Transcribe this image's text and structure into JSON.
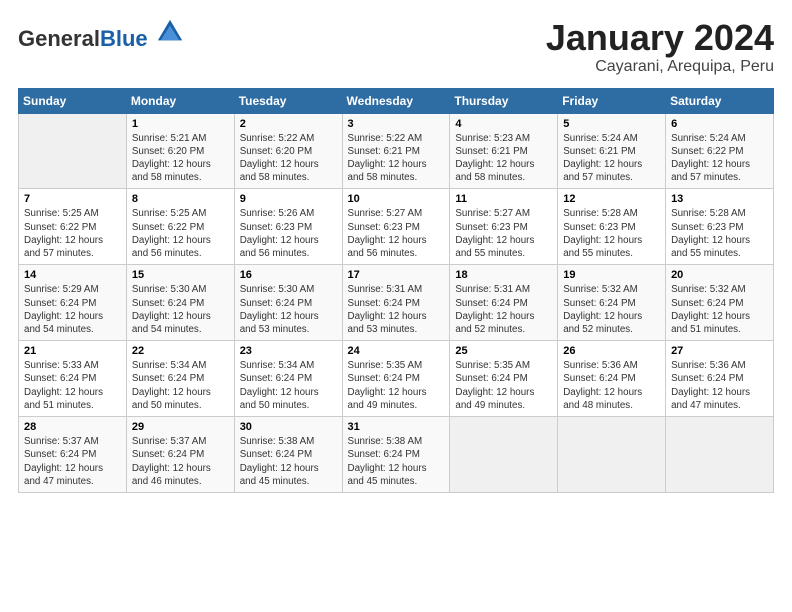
{
  "header": {
    "logo_general": "General",
    "logo_blue": "Blue",
    "month_title": "January 2024",
    "subtitle": "Cayarani, Arequipa, Peru"
  },
  "weekdays": [
    "Sunday",
    "Monday",
    "Tuesday",
    "Wednesday",
    "Thursday",
    "Friday",
    "Saturday"
  ],
  "weeks": [
    [
      {
        "day": "",
        "info": ""
      },
      {
        "day": "1",
        "info": "Sunrise: 5:21 AM\nSunset: 6:20 PM\nDaylight: 12 hours\nand 58 minutes."
      },
      {
        "day": "2",
        "info": "Sunrise: 5:22 AM\nSunset: 6:20 PM\nDaylight: 12 hours\nand 58 minutes."
      },
      {
        "day": "3",
        "info": "Sunrise: 5:22 AM\nSunset: 6:21 PM\nDaylight: 12 hours\nand 58 minutes."
      },
      {
        "day": "4",
        "info": "Sunrise: 5:23 AM\nSunset: 6:21 PM\nDaylight: 12 hours\nand 58 minutes."
      },
      {
        "day": "5",
        "info": "Sunrise: 5:24 AM\nSunset: 6:21 PM\nDaylight: 12 hours\nand 57 minutes."
      },
      {
        "day": "6",
        "info": "Sunrise: 5:24 AM\nSunset: 6:22 PM\nDaylight: 12 hours\nand 57 minutes."
      }
    ],
    [
      {
        "day": "7",
        "info": "Sunrise: 5:25 AM\nSunset: 6:22 PM\nDaylight: 12 hours\nand 57 minutes."
      },
      {
        "day": "8",
        "info": "Sunrise: 5:25 AM\nSunset: 6:22 PM\nDaylight: 12 hours\nand 56 minutes."
      },
      {
        "day": "9",
        "info": "Sunrise: 5:26 AM\nSunset: 6:23 PM\nDaylight: 12 hours\nand 56 minutes."
      },
      {
        "day": "10",
        "info": "Sunrise: 5:27 AM\nSunset: 6:23 PM\nDaylight: 12 hours\nand 56 minutes."
      },
      {
        "day": "11",
        "info": "Sunrise: 5:27 AM\nSunset: 6:23 PM\nDaylight: 12 hours\nand 55 minutes."
      },
      {
        "day": "12",
        "info": "Sunrise: 5:28 AM\nSunset: 6:23 PM\nDaylight: 12 hours\nand 55 minutes."
      },
      {
        "day": "13",
        "info": "Sunrise: 5:28 AM\nSunset: 6:23 PM\nDaylight: 12 hours\nand 55 minutes."
      }
    ],
    [
      {
        "day": "14",
        "info": "Sunrise: 5:29 AM\nSunset: 6:24 PM\nDaylight: 12 hours\nand 54 minutes."
      },
      {
        "day": "15",
        "info": "Sunrise: 5:30 AM\nSunset: 6:24 PM\nDaylight: 12 hours\nand 54 minutes."
      },
      {
        "day": "16",
        "info": "Sunrise: 5:30 AM\nSunset: 6:24 PM\nDaylight: 12 hours\nand 53 minutes."
      },
      {
        "day": "17",
        "info": "Sunrise: 5:31 AM\nSunset: 6:24 PM\nDaylight: 12 hours\nand 53 minutes."
      },
      {
        "day": "18",
        "info": "Sunrise: 5:31 AM\nSunset: 6:24 PM\nDaylight: 12 hours\nand 52 minutes."
      },
      {
        "day": "19",
        "info": "Sunrise: 5:32 AM\nSunset: 6:24 PM\nDaylight: 12 hours\nand 52 minutes."
      },
      {
        "day": "20",
        "info": "Sunrise: 5:32 AM\nSunset: 6:24 PM\nDaylight: 12 hours\nand 51 minutes."
      }
    ],
    [
      {
        "day": "21",
        "info": "Sunrise: 5:33 AM\nSunset: 6:24 PM\nDaylight: 12 hours\nand 51 minutes."
      },
      {
        "day": "22",
        "info": "Sunrise: 5:34 AM\nSunset: 6:24 PM\nDaylight: 12 hours\nand 50 minutes."
      },
      {
        "day": "23",
        "info": "Sunrise: 5:34 AM\nSunset: 6:24 PM\nDaylight: 12 hours\nand 50 minutes."
      },
      {
        "day": "24",
        "info": "Sunrise: 5:35 AM\nSunset: 6:24 PM\nDaylight: 12 hours\nand 49 minutes."
      },
      {
        "day": "25",
        "info": "Sunrise: 5:35 AM\nSunset: 6:24 PM\nDaylight: 12 hours\nand 49 minutes."
      },
      {
        "day": "26",
        "info": "Sunrise: 5:36 AM\nSunset: 6:24 PM\nDaylight: 12 hours\nand 48 minutes."
      },
      {
        "day": "27",
        "info": "Sunrise: 5:36 AM\nSunset: 6:24 PM\nDaylight: 12 hours\nand 47 minutes."
      }
    ],
    [
      {
        "day": "28",
        "info": "Sunrise: 5:37 AM\nSunset: 6:24 PM\nDaylight: 12 hours\nand 47 minutes."
      },
      {
        "day": "29",
        "info": "Sunrise: 5:37 AM\nSunset: 6:24 PM\nDaylight: 12 hours\nand 46 minutes."
      },
      {
        "day": "30",
        "info": "Sunrise: 5:38 AM\nSunset: 6:24 PM\nDaylight: 12 hours\nand 45 minutes."
      },
      {
        "day": "31",
        "info": "Sunrise: 5:38 AM\nSunset: 6:24 PM\nDaylight: 12 hours\nand 45 minutes."
      },
      {
        "day": "",
        "info": ""
      },
      {
        "day": "",
        "info": ""
      },
      {
        "day": "",
        "info": ""
      }
    ]
  ]
}
